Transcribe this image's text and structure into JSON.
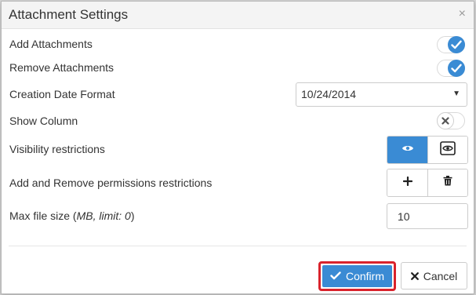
{
  "dialog": {
    "title": "Attachment Settings",
    "close_glyph": "×"
  },
  "rows": {
    "add_attachments": {
      "label": "Add Attachments",
      "enabled": true
    },
    "remove_attachments": {
      "label": "Remove Attachments",
      "enabled": true
    },
    "creation_date_format": {
      "label": "Creation Date Format",
      "value": "10/24/2014"
    },
    "show_column": {
      "label": "Show Column",
      "enabled": false
    },
    "visibility_restrictions": {
      "label": "Visibility restrictions"
    },
    "add_remove_permissions": {
      "label": "Add and Remove permissions restrictions"
    },
    "max_file_size": {
      "label_prefix": "Max file size (",
      "label_italic": "MB, limit: 0",
      "label_suffix": ")",
      "value": "10"
    }
  },
  "footer": {
    "confirm_label": "Confirm",
    "cancel_label": "Cancel"
  },
  "colors": {
    "accent": "#3a8bd4",
    "highlight_border": "#d9232c"
  }
}
